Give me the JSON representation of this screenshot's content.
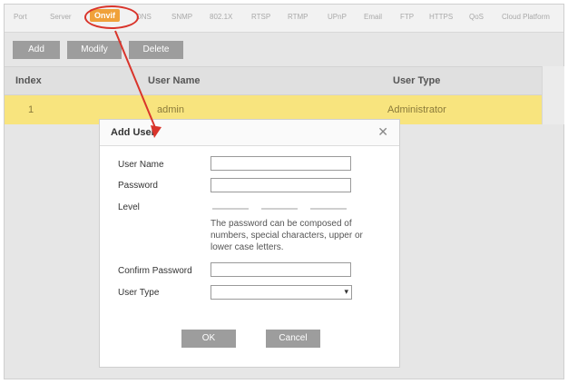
{
  "tabs": [
    {
      "label": "Port"
    },
    {
      "label": "Server"
    },
    {
      "label": "Onvif"
    },
    {
      "label": "DNS"
    },
    {
      "label": "SNMP"
    },
    {
      "label": "802.1X"
    },
    {
      "label": "RTSP"
    },
    {
      "label": "RTMP"
    },
    {
      "label": "UPnP"
    },
    {
      "label": "Email"
    },
    {
      "label": "FTP"
    },
    {
      "label": "HTTPS"
    },
    {
      "label": "QoS"
    },
    {
      "label": "Cloud Platform"
    }
  ],
  "toolbar": {
    "add_label": "Add",
    "modify_label": "Modify",
    "delete_label": "Delete"
  },
  "table": {
    "columns": [
      "Index",
      "User Name",
      "User Type"
    ],
    "rows": [
      {
        "index": "1",
        "user_name": "admin",
        "user_type": "Administrator"
      }
    ]
  },
  "dialog": {
    "title": "Add User",
    "close_icon": "close-icon",
    "user_name_label": "User Name",
    "user_name_value": "",
    "password_label": "Password",
    "password_value": "",
    "level_label": "Level",
    "hint": "The password can be composed of numbers, special characters, upper or lower case letters.",
    "confirm_password_label": "Confirm Password",
    "confirm_password_value": "",
    "user_type_label": "User Type",
    "user_type_value": "",
    "ok_label": "OK",
    "cancel_label": "Cancel"
  },
  "colors": {
    "active_tab": "#f0a13a",
    "selected_row": "#f8e47e",
    "annotation": "#d9342b",
    "button": "#9d9d9d"
  }
}
